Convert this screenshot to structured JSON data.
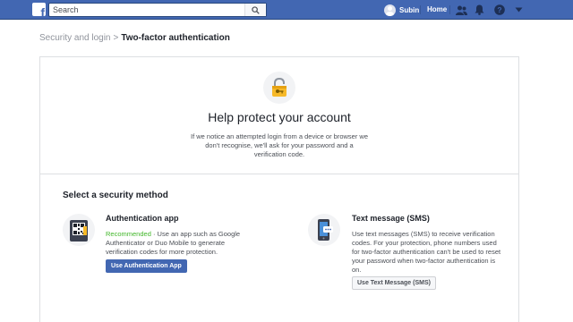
{
  "topbar": {
    "logo_letter": "f",
    "search_placeholder": "Search",
    "user_name": "Subin",
    "home_label": "Home",
    "icons": [
      "friend-requests-icon",
      "notifications-icon",
      "help-icon",
      "account-menu-icon"
    ]
  },
  "breadcrumb": {
    "parent": "Security and login",
    "separator": ">",
    "current": "Two-factor authentication"
  },
  "hero": {
    "icon": "lock-icon",
    "title": "Help protect your account",
    "description": "If we notice an attempted login from a device or browser we don't recognise, we'll ask for your password and a verification code."
  },
  "security_methods": {
    "title": "Select a security method",
    "auth_app": {
      "icon": "qr-phone-icon",
      "title": "Authentication app",
      "recommended": "Recommended",
      "description": " · Use an app such as Google Authenticator or Duo Mobile to generate verification codes for more protection.",
      "button": "Use Authentication App"
    },
    "sms": {
      "icon": "sms-phone-icon",
      "title": "Text message (SMS)",
      "description": "Use text messages (SMS) to receive verification codes. For your protection, phone numbers used for two-factor authentication can't be used to reset your password when two-factor authentication is on.",
      "button": "Use Text Message (SMS)"
    }
  },
  "colors": {
    "brand": "#4267b2",
    "recommended": "#42b72a"
  }
}
